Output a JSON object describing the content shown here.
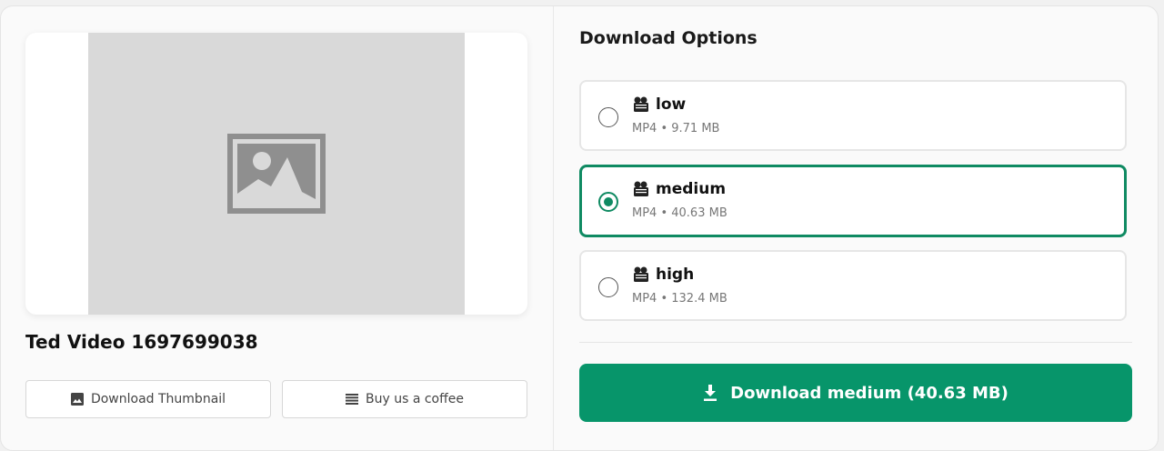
{
  "video": {
    "title": "Ted Video 1697699038"
  },
  "buttons": {
    "download_thumbnail": "Download Thumbnail",
    "buy_coffee": "Buy us a coffee",
    "download_main": "Download medium (40.63 MB)"
  },
  "download_options": {
    "title": "Download Options",
    "options": [
      {
        "label": "low",
        "meta": "MP4 • 9.71 MB",
        "selected": false
      },
      {
        "label": "medium",
        "meta": "MP4 • 40.63 MB",
        "selected": true
      },
      {
        "label": "high",
        "meta": "MP4 • 132.4 MB",
        "selected": false
      }
    ]
  },
  "colors": {
    "accent": "#07956a",
    "selected_border": "#0f8a62",
    "thumbnail_placeholder": "#d9d9d9"
  },
  "icons": {
    "thumbnail_placeholder": "image-placeholder-icon",
    "download_thumbnail": "image-icon",
    "buy_coffee": "menu-lines-icon",
    "option": "film-camera-icon",
    "download": "download-icon"
  }
}
